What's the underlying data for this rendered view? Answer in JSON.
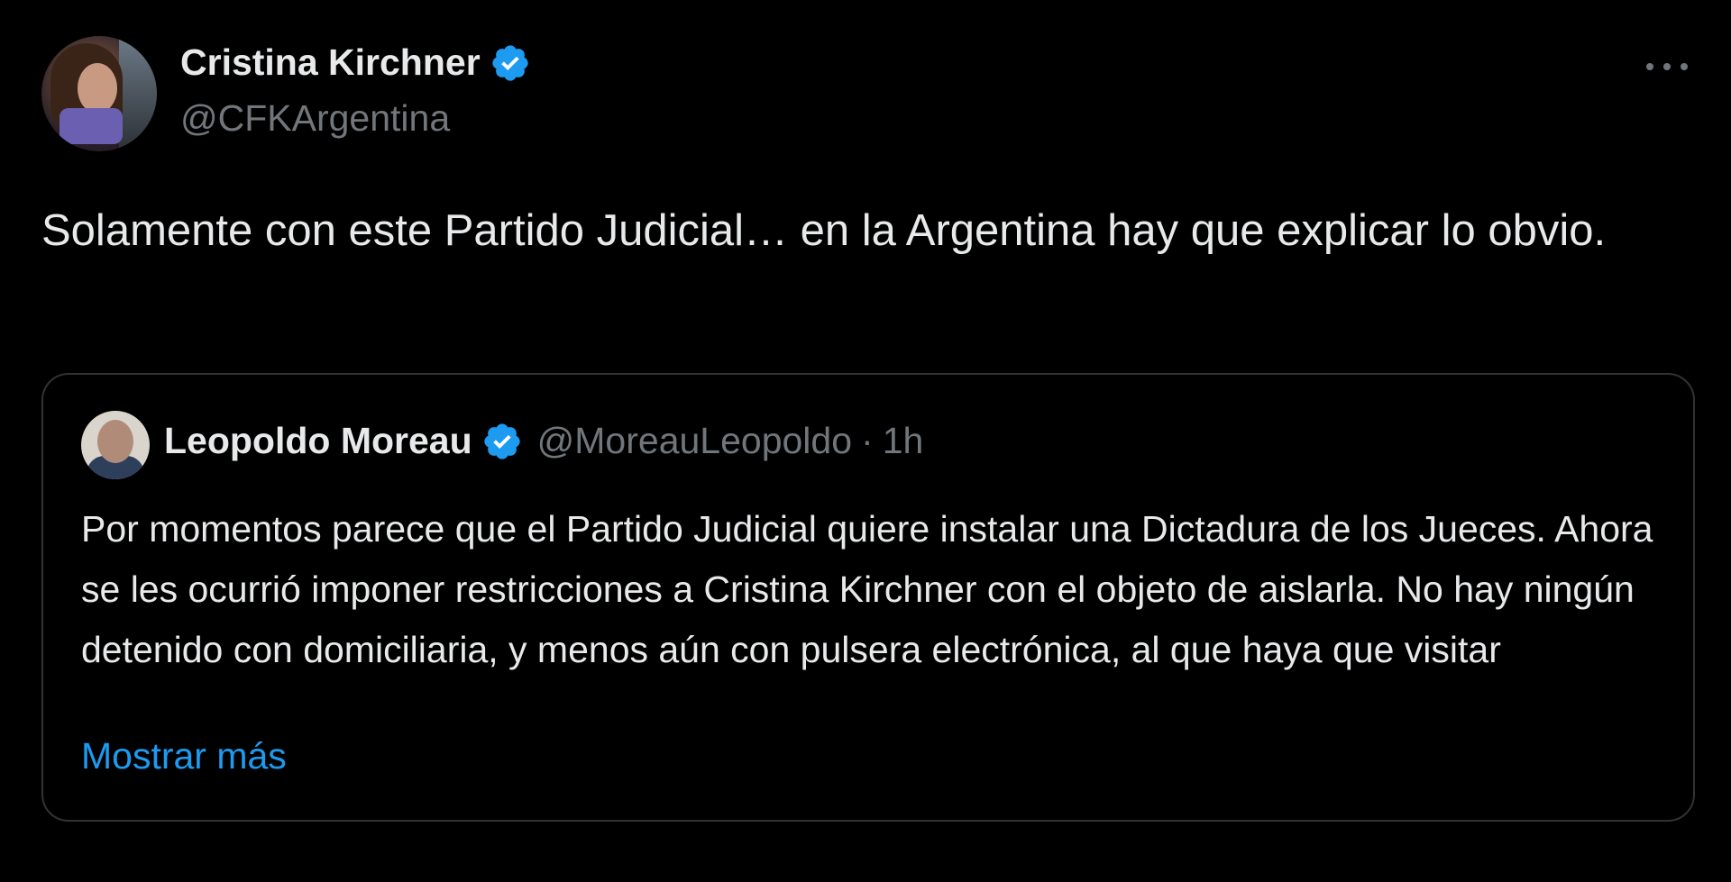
{
  "author": {
    "display_name": "Cristina Kirchner",
    "handle": "@CFKArgentina",
    "verified": true,
    "avatar_icon": "profile-photo"
  },
  "tweet": {
    "text": "Solamente con este Partido Judicial… en la Argentina hay que explicar lo obvio."
  },
  "menu": {
    "icon": "more-options-icon"
  },
  "quoted_tweet": {
    "display_name": "Leopoldo Moreau",
    "handle": "@MoreauLeopoldo",
    "separator": "·",
    "time": "1h",
    "verified": true,
    "text": "Por momentos parece que el Partido Judicial quiere instalar una Dictadura de los Jueces. Ahora se les ocurrió imponer restricciones a Cristina Kirchner con el objeto de aislarla. No hay ningún detenido con domiciliaria, y menos aún con pulsera electrónica, al que haya que visitar",
    "show_more": "Mostrar más"
  },
  "colors": {
    "background": "#000000",
    "text": "#e7e9ea",
    "secondary": "#71767b",
    "link": "#1d9bf0",
    "verified": "#1d9bf0",
    "border": "#2f3336"
  }
}
